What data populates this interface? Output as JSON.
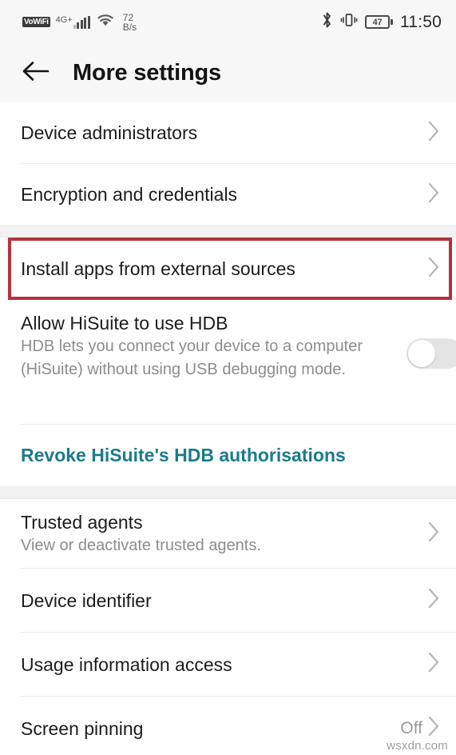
{
  "status_bar": {
    "vowifi_label": "VoWiFi",
    "network_type": "4G+",
    "data_speed_value": "72",
    "data_speed_unit": "B/s",
    "battery_percent": "47",
    "time": "11:50",
    "icons": [
      "vowifi-icon",
      "signal-bars-icon",
      "wifi-icon",
      "bluetooth-icon",
      "vibrate-icon",
      "battery-icon"
    ]
  },
  "header": {
    "back_icon": "back-arrow-icon",
    "title": "More settings"
  },
  "sections": [
    {
      "rows": [
        {
          "label": "Device administrators",
          "sub": "",
          "value": "",
          "chevron": true
        },
        {
          "label": "Encryption and credentials",
          "sub": "",
          "value": "",
          "chevron": true
        }
      ]
    },
    {
      "highlighted": true,
      "rows": [
        {
          "label": "Install apps from external sources",
          "sub": "",
          "value": "",
          "chevron": true
        }
      ]
    },
    {
      "rows": [
        {
          "label": "Allow HiSuite to use HDB",
          "sub": "HDB lets you connect your device to a computer (HiSuite) without using USB debugging mode.",
          "value": "",
          "toggle": "off"
        }
      ],
      "link": "Revoke HiSuite's HDB authorisations"
    },
    {
      "rows": [
        {
          "label": "Trusted agents",
          "sub": "View or deactivate trusted agents.",
          "value": "",
          "chevron": true
        },
        {
          "label": "Device identifier",
          "sub": "",
          "value": "",
          "chevron": true
        },
        {
          "label": "Usage information access",
          "sub": "",
          "value": "",
          "chevron": true
        },
        {
          "label": "Screen pinning",
          "sub": "",
          "value": "Off",
          "chevron": true
        }
      ]
    }
  ],
  "colors": {
    "highlight_border": "#b5323c",
    "link_teal": "#1b7b8c",
    "header_bg": "#f7f7f7",
    "divider": "#ececec"
  },
  "watermark": "wsxdn.com"
}
